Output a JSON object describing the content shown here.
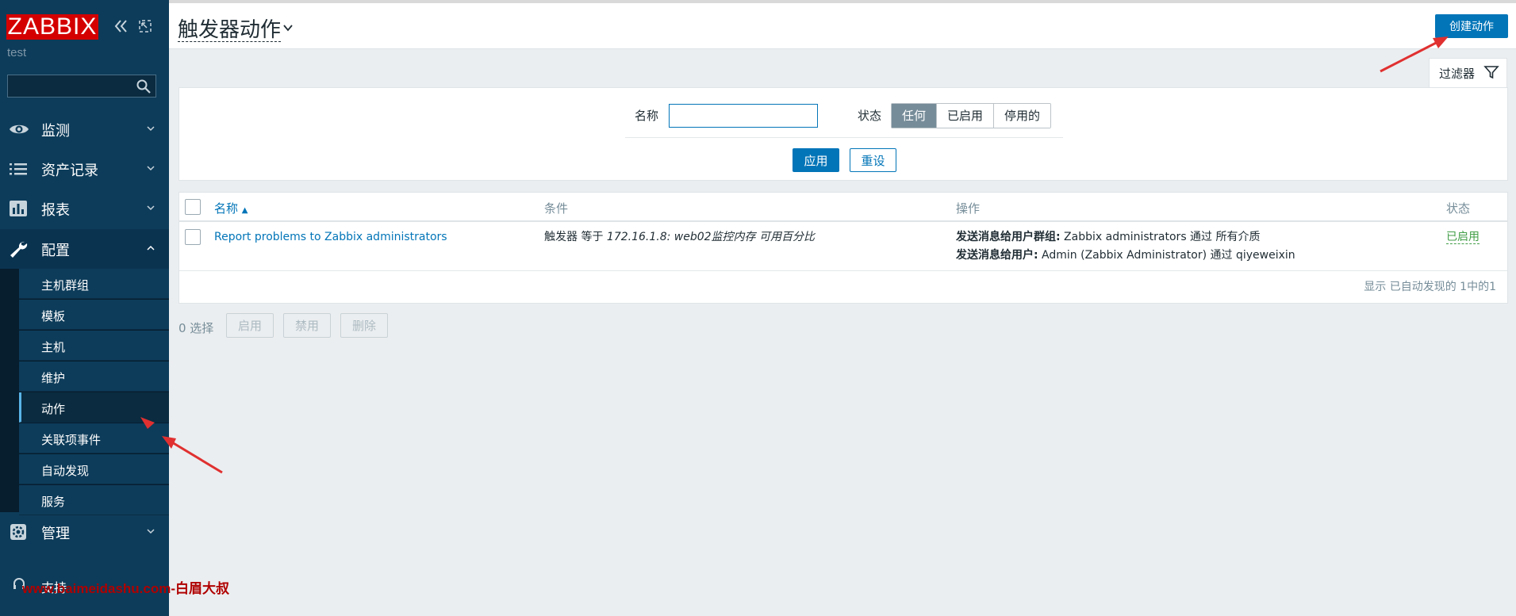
{
  "sidebar": {
    "logo": "ZABBIX",
    "server_name": "test",
    "search": {
      "value": "",
      "placeholder": ""
    },
    "menu": [
      {
        "label": "监测",
        "icon": "eye-icon"
      },
      {
        "label": "资产记录",
        "icon": "list-icon"
      },
      {
        "label": "报表",
        "icon": "bar-chart-icon"
      },
      {
        "label": "配置",
        "icon": "wrench-icon"
      },
      {
        "label": "管理",
        "icon": "gear-icon"
      }
    ],
    "submenu": [
      "主机群组",
      "模板",
      "主机",
      "维护",
      "动作",
      "关联项事件",
      "自动发现",
      "服务"
    ],
    "active_submenu": "动作",
    "support_label": "支持",
    "watermark": "www.baimeidashu.com-白眉大叔"
  },
  "header": {
    "title": "触发器动作",
    "create_button": "创建动作"
  },
  "filter": {
    "tab_label": "过滤器",
    "name_label": "名称",
    "name_value": "",
    "status_label": "状态",
    "status_options": [
      "任何",
      "已启用",
      "停用的"
    ],
    "status_selected": "任何",
    "apply": "应用",
    "reset": "重设"
  },
  "table": {
    "headers": {
      "name": "名称",
      "conditions": "条件",
      "operations": "操作",
      "status": "状态"
    },
    "rows": [
      {
        "name": "Report problems to Zabbix administrators",
        "condition_prefix": "触发器 等于 ",
        "condition_value": "172.16.1.8: web02监控内存 可用百分比",
        "op1_bold": "发送消息给用户群组:",
        "op1_text": " Zabbix administrators 通过 所有介质",
        "op2_bold": "发送消息给用户:",
        "op2_text": " Admin (Zabbix Administrator) 通过 qiyeweixin",
        "status": "已启用"
      }
    ],
    "footer": "显示 已自动发现的 1中的1"
  },
  "mass_actions": {
    "selected": "0 选择",
    "enable": "启用",
    "disable": "禁用",
    "delete": "删除"
  },
  "colors": {
    "sidebar_bg": "#0d3c5a",
    "accent": "#0275b8",
    "logo_red": "#d40000",
    "enabled_green": "#429e47"
  }
}
